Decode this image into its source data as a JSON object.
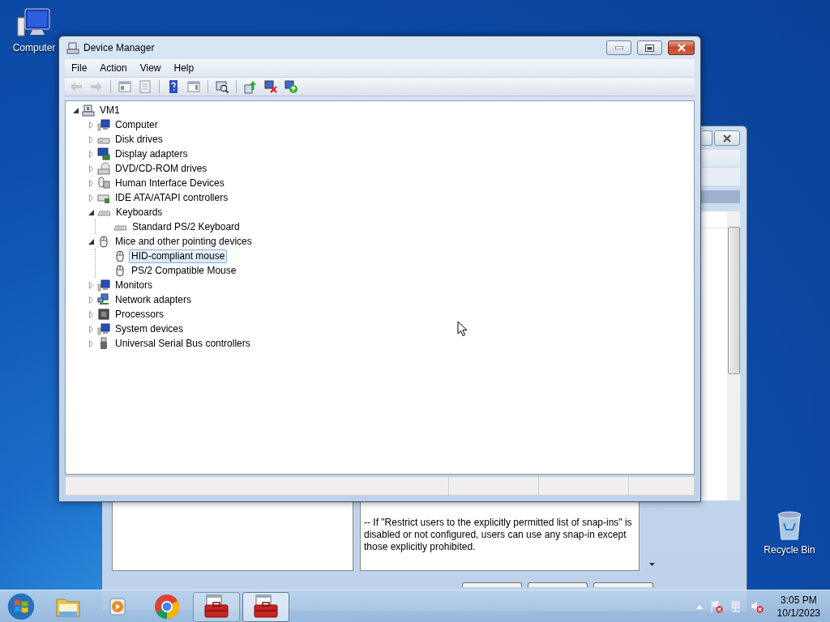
{
  "desktop_icons": [
    {
      "label": "Computer",
      "kind": "computer"
    },
    {
      "label": "Recycle Bin",
      "kind": "recycle"
    }
  ],
  "background_window": {
    "description": "--  If \"Restrict users to the explicitly permitted list of snap-ins\" is disabled or not configured, users can use any snap-in except those explicitly prohibited."
  },
  "window": {
    "title": "Device Manager",
    "menu": [
      "File",
      "Action",
      "View",
      "Help"
    ],
    "toolbar": [
      {
        "kind": "back",
        "disabled": true
      },
      {
        "kind": "forward",
        "disabled": true
      },
      {
        "kind": "console-tree",
        "disabled": false
      },
      {
        "kind": "properties",
        "disabled": false
      },
      {
        "kind": "help",
        "disabled": false
      },
      {
        "kind": "action-pane",
        "disabled": false
      },
      {
        "kind": "scan",
        "disabled": false
      },
      {
        "kind": "update-driver",
        "disabled": false
      },
      {
        "kind": "uninstall",
        "disabled": false
      },
      {
        "kind": "add-hardware",
        "disabled": false
      }
    ],
    "tree": {
      "label": "VM1",
      "kind": "host",
      "expanded": true,
      "selected": false,
      "children": [
        {
          "label": "Computer",
          "kind": "monitor",
          "expanded": false,
          "selected": false
        },
        {
          "label": "Disk drives",
          "kind": "drive",
          "expanded": false,
          "selected": false
        },
        {
          "label": "Display adapters",
          "kind": "display",
          "expanded": false,
          "selected": false
        },
        {
          "label": "DVD/CD-ROM drives",
          "kind": "dvd",
          "expanded": false,
          "selected": false
        },
        {
          "label": "Human Interface Devices",
          "kind": "hid",
          "expanded": false,
          "selected": false
        },
        {
          "label": "IDE ATA/ATAPI controllers",
          "kind": "controller",
          "expanded": false,
          "selected": false
        },
        {
          "label": "Keyboards",
          "kind": "keyboard",
          "expanded": true,
          "selected": false,
          "children": [
            {
              "label": "Standard PS/2 Keyboard",
              "kind": "keyboard",
              "selected": false
            }
          ]
        },
        {
          "label": "Mice and other pointing devices",
          "kind": "mouse",
          "expanded": true,
          "selected": false,
          "children": [
            {
              "label": "HID-compliant mouse",
              "kind": "mouse",
              "selected": true
            },
            {
              "label": "PS/2 Compatible Mouse",
              "kind": "mouse",
              "selected": false
            }
          ]
        },
        {
          "label": "Monitors",
          "kind": "monitor",
          "expanded": false,
          "selected": false
        },
        {
          "label": "Network adapters",
          "kind": "network",
          "expanded": false,
          "selected": false
        },
        {
          "label": "Processors",
          "kind": "chip",
          "expanded": false,
          "selected": false
        },
        {
          "label": "System devices",
          "kind": "monitor",
          "expanded": false,
          "selected": false
        },
        {
          "label": "Universal Serial Bus controllers",
          "kind": "usb",
          "expanded": false,
          "selected": false
        }
      ]
    }
  },
  "taskbar": {
    "items": [
      {
        "kind": "folder",
        "running": false,
        "selected": false
      },
      {
        "kind": "media",
        "running": false,
        "selected": false
      },
      {
        "kind": "browser",
        "running": false,
        "selected": false
      },
      {
        "kind": "toolbox",
        "running": true,
        "selected": false
      },
      {
        "kind": "toolbox",
        "running": true,
        "selected": true
      }
    ],
    "tray": [
      {
        "kind": "caret"
      },
      {
        "kind": "flag"
      },
      {
        "kind": "network"
      },
      {
        "kind": "speaker"
      }
    ],
    "time": "3:05 PM",
    "date": "10/1/2023"
  }
}
